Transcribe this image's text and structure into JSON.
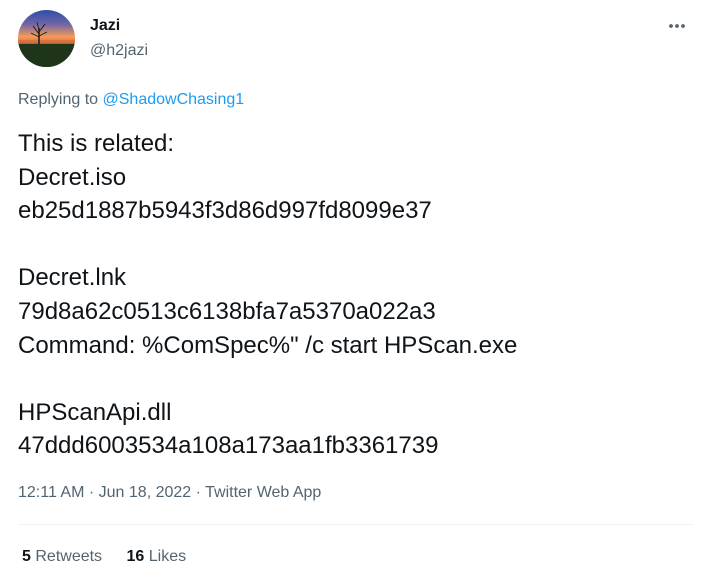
{
  "author": {
    "display_name": "Jazi",
    "handle": "@h2jazi"
  },
  "more_icon": "more-horizontal-icon",
  "reply": {
    "prefix": "Replying to",
    "user": "@ShadowChasing1"
  },
  "tweet": {
    "text": "This is related:\nDecret.iso\neb25d1887b5943f3d86d997fd8099e37\n\nDecret.lnk\n79d8a62c0513c6138bfa7a5370a022a3\nCommand: %ComSpec%\" /c start HPScan.exe\n\nHPScanApi.dll\n47ddd6003534a108a173aa1fb3361739"
  },
  "meta": {
    "time": "12:11 AM",
    "separator": "·",
    "date": "Jun 18, 2022",
    "source": "Twitter Web App"
  },
  "stats": {
    "retweets_count": "5",
    "retweets_label": "Retweets",
    "likes_count": "16",
    "likes_label": "Likes"
  },
  "colors": {
    "text_primary": "#0f1419",
    "text_secondary": "#536471",
    "link": "#1d9bf0",
    "divider": "#eff3f4"
  }
}
